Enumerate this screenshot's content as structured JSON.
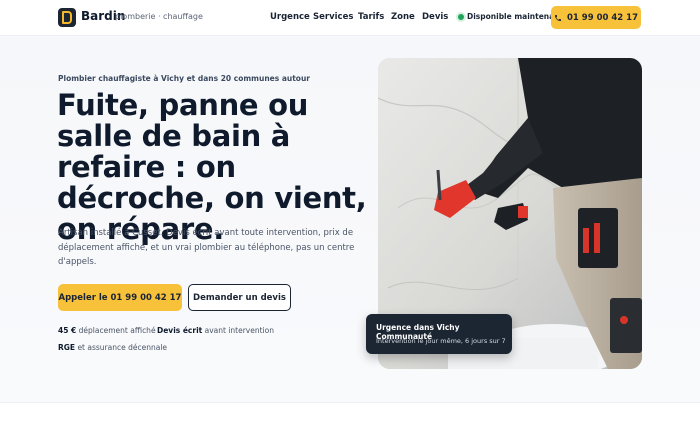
{
  "header": {
    "brand": "Bardin",
    "tagline": "plomberie · chauffage",
    "nav": [
      "Urgence",
      "Services",
      "Tarifs",
      "Zone",
      "Devis"
    ],
    "availability": "Disponible maintenant",
    "call_label": "01 99 00 42 17"
  },
  "hero": {
    "eyebrow": "Plombier chauffagiste à Vichy et dans 20 communes autour",
    "title": "Fuite, panne ou salle de bain à refaire : on décroche, on vient, on répare.",
    "lead": "Artisan installé à Cusset. Devis écrit avant toute intervention, prix de déplacement affiché, et un vrai plombier au téléphone, pas un centre d'appels.",
    "primary_cta": "Appeler le 01 99 00 42 17",
    "secondary_cta": "Demander un devis",
    "facts": [
      {
        "strong": "45 €",
        "text": " déplacement affiché"
      },
      {
        "strong": "Devis écrit",
        "text": " avant intervention"
      },
      {
        "strong": "RGE",
        "text": " et assurance décennale"
      }
    ]
  },
  "badge": {
    "title": "Urgence dans Vichy Communauté",
    "subtitle": "Intervention le jour même, 6 jours sur 7"
  },
  "colors": {
    "accent": "#f7c13a",
    "dark": "#1c2532",
    "available": "#22a35a"
  },
  "icons": [
    "logo-b-icon",
    "phone-icon",
    "status-dot-icon"
  ]
}
